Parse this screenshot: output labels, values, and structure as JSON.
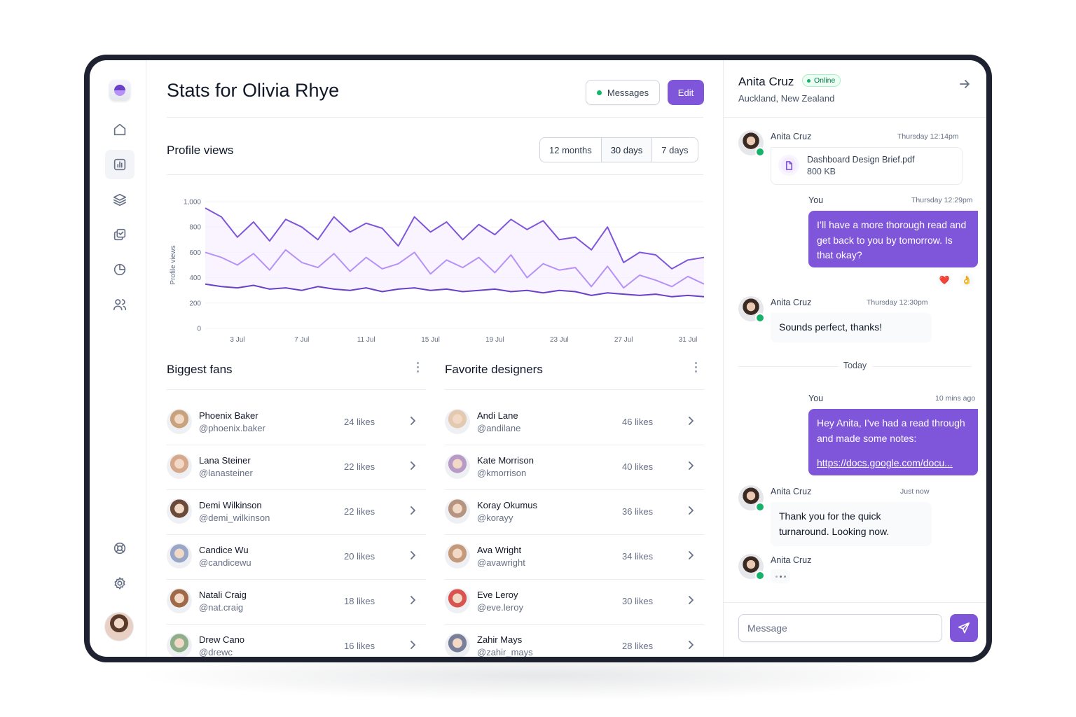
{
  "page": {
    "title": "Stats for Olivia Rhye",
    "messages_button": "Messages",
    "edit_button": "Edit",
    "colors": {
      "accent": "#7F56D9",
      "online": "#17B26A"
    }
  },
  "sidebar": {
    "items": [
      {
        "icon": "home-icon"
      },
      {
        "icon": "bar-chart-icon",
        "active": true
      },
      {
        "icon": "layers-icon"
      },
      {
        "icon": "check-squares-icon"
      },
      {
        "icon": "pie-chart-icon"
      },
      {
        "icon": "users-icon"
      }
    ],
    "bottom": [
      {
        "icon": "life-buoy-icon"
      },
      {
        "icon": "settings-icon"
      }
    ]
  },
  "profile_views": {
    "title": "Profile views",
    "ranges": [
      "12 months",
      "30 days",
      "7 days"
    ],
    "selected_range": "30 days"
  },
  "chart_data": {
    "type": "line",
    "xlabel": "",
    "ylabel": "Profile views",
    "ylim": [
      0,
      1000
    ],
    "yticks": [
      "0",
      "200",
      "400",
      "600",
      "800",
      "1,000"
    ],
    "x_tick_labels": [
      "3 Jul",
      "7 Jul",
      "11 Jul",
      "15 Jul",
      "19 Jul",
      "23 Jul",
      "27 Jul",
      "31 Jul"
    ],
    "x_range": [
      1,
      32
    ],
    "grid": true,
    "legend": "none",
    "series": [
      {
        "color": "#7F56D9",
        "x": [
          1,
          2,
          3,
          4,
          5,
          6,
          7,
          8,
          9,
          10,
          11,
          12,
          13,
          14,
          15,
          16,
          17,
          18,
          19,
          20,
          21,
          22,
          23,
          24,
          25,
          26,
          27,
          28,
          29,
          30,
          31,
          32
        ],
        "values": [
          950,
          880,
          720,
          840,
          690,
          860,
          800,
          700,
          880,
          760,
          830,
          790,
          650,
          880,
          760,
          840,
          700,
          820,
          740,
          860,
          780,
          850,
          700,
          720,
          620,
          800,
          520,
          600,
          580,
          470,
          540,
          560
        ]
      },
      {
        "color": "#B692F6",
        "x": [
          1,
          2,
          3,
          4,
          5,
          6,
          7,
          8,
          9,
          10,
          11,
          12,
          13,
          14,
          15,
          16,
          17,
          18,
          19,
          20,
          21,
          22,
          23,
          24,
          25,
          26,
          27,
          28,
          29,
          30,
          31,
          32
        ],
        "values": [
          600,
          560,
          500,
          590,
          460,
          620,
          520,
          480,
          590,
          450,
          560,
          470,
          510,
          600,
          430,
          540,
          480,
          560,
          440,
          580,
          400,
          510,
          460,
          480,
          330,
          490,
          320,
          420,
          380,
          330,
          410,
          350
        ]
      },
      {
        "color": "#6941C6",
        "x": [
          1,
          2,
          3,
          4,
          5,
          6,
          7,
          8,
          9,
          10,
          11,
          12,
          13,
          14,
          15,
          16,
          17,
          18,
          19,
          20,
          21,
          22,
          23,
          24,
          25,
          26,
          27,
          28,
          29,
          30,
          31,
          32
        ],
        "values": [
          350,
          330,
          320,
          340,
          310,
          320,
          300,
          330,
          310,
          300,
          320,
          290,
          310,
          320,
          300,
          310,
          290,
          300,
          310,
          290,
          300,
          280,
          300,
          290,
          260,
          280,
          270,
          260,
          270,
          250,
          260,
          250
        ]
      }
    ]
  },
  "biggest_fans": {
    "title": "Biggest fans",
    "items": [
      {
        "name": "Phoenix Baker",
        "handle": "@phoenix.baker",
        "likes": "24 likes",
        "tone": "#c8a27c"
      },
      {
        "name": "Lana Steiner",
        "handle": "@lanasteiner",
        "likes": "22 likes",
        "tone": "#d7a98c"
      },
      {
        "name": "Demi Wilkinson",
        "handle": "@demi_wilkinson",
        "likes": "22 likes",
        "tone": "#6b4a3a"
      },
      {
        "name": "Candice Wu",
        "handle": "@candicewu",
        "likes": "20 likes",
        "tone": "#9aa6c8"
      },
      {
        "name": "Natali Craig",
        "handle": "@nat.craig",
        "likes": "18 likes",
        "tone": "#a06a48"
      },
      {
        "name": "Drew Cano",
        "handle": "@drewc",
        "likes": "16 likes",
        "tone": "#8fae8a"
      }
    ]
  },
  "favorite_designers": {
    "title": "Favorite designers",
    "items": [
      {
        "name": "Andi Lane",
        "handle": "@andilane",
        "likes": "46 likes",
        "tone": "#e3c9b0"
      },
      {
        "name": "Kate Morrison",
        "handle": "@kmorrison",
        "likes": "40 likes",
        "tone": "#b79bc6"
      },
      {
        "name": "Koray Okumus",
        "handle": "@korayy",
        "likes": "36 likes",
        "tone": "#b59480"
      },
      {
        "name": "Ava Wright",
        "handle": "@avawright",
        "likes": "34 likes",
        "tone": "#c49a7a"
      },
      {
        "name": "Eve Leroy",
        "handle": "@eve.leroy",
        "likes": "30 likes",
        "tone": "#d9534f"
      },
      {
        "name": "Zahir Mays",
        "handle": "@zahir_mays",
        "likes": "28 likes",
        "tone": "#7a7f99"
      }
    ]
  },
  "chat": {
    "contact_name": "Anita Cruz",
    "status": "Online",
    "location": "Auckland, New Zealand",
    "messages": [
      {
        "sender": "Anita Cruz",
        "time": "Thursday 12:14pm",
        "file_name": "Dashboard Design Brief.pdf",
        "file_size": "800 KB"
      },
      {
        "sender": "You",
        "time": "Thursday 12:29pm",
        "text": "I’ll have a more thorough read and get back to you by tomorrow. Is that okay?",
        "reactions": [
          "❤️",
          "👌"
        ]
      },
      {
        "sender": "Anita Cruz",
        "time": "Thursday 12:30pm",
        "text": "Sounds perfect, thanks!"
      },
      {
        "sender": "You",
        "time": "10 mins ago",
        "text": "Hey Anita, I’ve had a read through and made some notes:",
        "link": "https://docs.google.com/docu..."
      },
      {
        "sender": "Anita Cruz",
        "time": "Just now",
        "text": "Thank you for the quick turnaround. Looking now."
      },
      {
        "sender": "Anita Cruz",
        "typing": true
      }
    ],
    "divider": "Today",
    "input_placeholder": "Message"
  }
}
